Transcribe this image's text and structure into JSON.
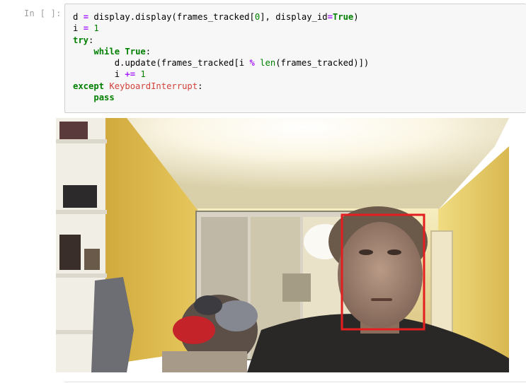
{
  "cell": {
    "prompt": "In [ ]:",
    "code_lines": [
      "d = display.display(frames_tracked[0], display_id=True)",
      "i = 1",
      "try:",
      "    while True:",
      "        d.update(frames_tracked[i % len(frames_tracked)])",
      "        i += 1",
      "except KeyboardInterrupt:",
      "    pass"
    ]
  },
  "output": {
    "image_description_name": "webcam-frame",
    "face_box_color": "#e41e1e"
  },
  "colors": {
    "keyword": "#008000",
    "operator": "#aa22ff",
    "cell_background": "#f7f7f7",
    "prompt": "#a0a0a0"
  }
}
